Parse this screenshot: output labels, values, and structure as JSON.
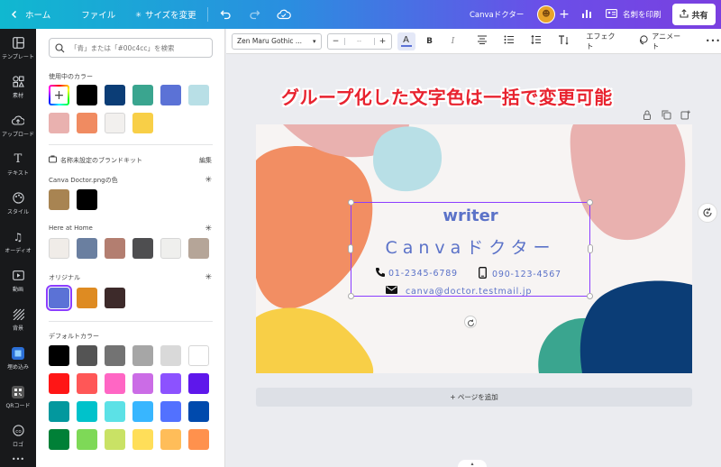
{
  "topbar": {
    "home": "ホーム",
    "file": "ファイル",
    "resize": "サイズを変更",
    "doc_title": "Canvaドクター",
    "print": "名刺を印刷",
    "share": "共有"
  },
  "rail": [
    {
      "label": "テンプレート",
      "icon": "template-icon"
    },
    {
      "label": "素材",
      "icon": "elements-icon"
    },
    {
      "label": "アップロード",
      "icon": "upload-icon"
    },
    {
      "label": "テキスト",
      "icon": "text-icon"
    },
    {
      "label": "スタイル",
      "icon": "style-icon"
    },
    {
      "label": "オーディオ",
      "icon": "audio-icon"
    },
    {
      "label": "動画",
      "icon": "video-icon"
    },
    {
      "label": "背景",
      "icon": "background-icon"
    },
    {
      "label": "埋め込み",
      "icon": "embed-icon"
    },
    {
      "label": "QRコード",
      "icon": "qr-icon"
    },
    {
      "label": "ロゴ",
      "icon": "logo-icon"
    }
  ],
  "panel": {
    "search_placeholder": "「青」または「#00c4cc」を検索",
    "in_use_label": "使用中のカラー",
    "in_use": [
      "#000000",
      "#0b3d76",
      "#3aa58f",
      "#5b72d6",
      "#b8dfe6",
      "#e9b1af",
      "#f08b61",
      "#f2f0ee",
      "#f8cf47"
    ],
    "brandkit_label": "名称未設定のブランドキット",
    "edit_label": "編集",
    "canva_doctor_label": "Canva Doctor.pngの色",
    "canva_doctor": [
      "#a88452",
      "#000000"
    ],
    "here_home_label": "Here at Home",
    "here_home": [
      "#f0ece8",
      "#6a7fa0",
      "#b37e70",
      "#4e4e50",
      "#efefed",
      "#b5a598"
    ],
    "original_label": "オリジナル",
    "original": [
      "#5b72d6",
      "#de8b22",
      "#3d2a2a"
    ],
    "default_label": "デフォルトカラー",
    "default": [
      "#000000",
      "#545454",
      "#737373",
      "#a6a6a6",
      "#d9d9d9",
      "#ffffff",
      "#ff1616",
      "#ff5757",
      "#ff66c4",
      "#cb6ce6",
      "#8c52ff",
      "#5e17eb",
      "#03989e",
      "#00c2cb",
      "#5ce1e6",
      "#38b6ff",
      "#5271ff",
      "#004aad",
      "#008037",
      "#7ed957",
      "#c9e265",
      "#ffde59",
      "#ffbd59",
      "#ff914d"
    ]
  },
  "texttoolbar": {
    "font": "Zen Maru Gothic ...",
    "size_minus": "−",
    "size_value": "-- ",
    "size_plus": "+",
    "bold": "B",
    "italic": "I",
    "effect": "エフェクト",
    "animate": "アニメート",
    "more": "•••"
  },
  "headline": "グループ化した文字色は一括で変更可能",
  "card": {
    "writer": "writer",
    "brand": "Canvaドクター",
    "phone": "01-2345-6789",
    "mobile": "090-123-4567",
    "email": "canva@doctor.testmail.jp"
  },
  "addpage": "+ ページを追加"
}
